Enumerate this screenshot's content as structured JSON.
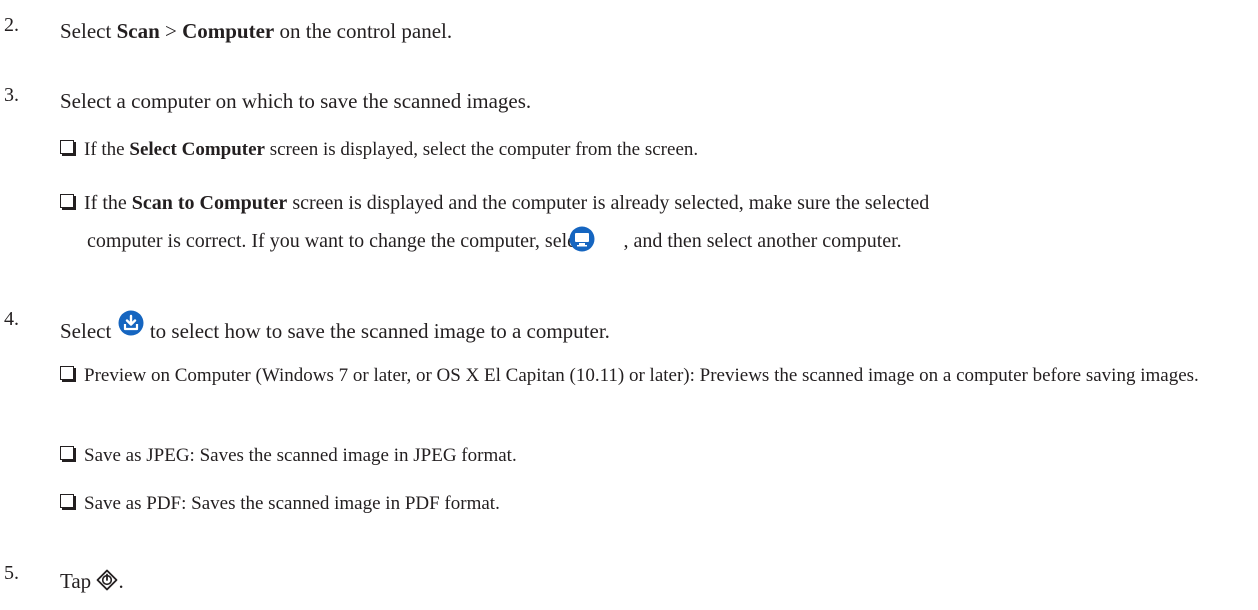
{
  "steps": [
    {
      "number": "2.",
      "parts": {
        "a": "Select ",
        "b1": "Scan",
        "c": " > ",
        "b2": "Computer",
        "d": " on the control panel."
      }
    },
    {
      "number": "3.",
      "text": "Select a computer on which to save the scanned images.",
      "sub": [
        {
          "a": "If the ",
          "bold": "Select Computer",
          "b": " screen is displayed, select the computer from the screen."
        },
        {
          "a": "If the ",
          "bold": "Scan to Computer",
          "b": " screen is displayed and the computer is already selected, make sure the selected",
          "c": "computer is correct. If you want to change the computer, select ",
          "d": ", and then select another computer."
        }
      ]
    },
    {
      "number": "4.",
      "a": "Select ",
      "b": " to select how to save the scanned image to a computer.",
      "sub": [
        "Preview on Computer (Windows 7 or later, or OS X El Capitan (10.11) or later): Previews the scanned image on a computer before saving images.",
        "Save as JPEG: Saves the scanned image in JPEG format.",
        "Save as PDF: Saves the scanned image in PDF format."
      ]
    },
    {
      "number": "5.",
      "a": "Tap ",
      "b": "."
    }
  ],
  "icons": {
    "computer": "computer-monitor-icon",
    "save_options": "download-tray-icon",
    "start": "start-diamond-icon"
  },
  "colors": {
    "text": "#231f20",
    "icon_blue": "#1565c0"
  }
}
